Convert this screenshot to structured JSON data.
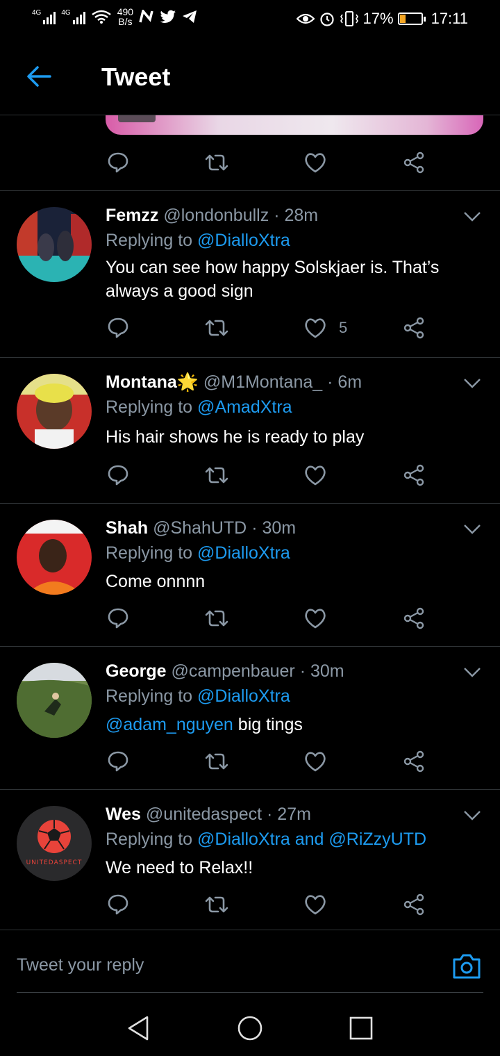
{
  "status_bar": {
    "net1": "4G",
    "net2": "4G",
    "speed_value": "490",
    "speed_unit": "B/s",
    "notif_icons": [
      "n-icon",
      "twitter-icon",
      "telegram-icon"
    ],
    "battery_percent": "17%",
    "time": "17:11"
  },
  "header": {
    "title": "Tweet"
  },
  "tweets": [
    {
      "name": "Femzz",
      "handle": "@londonbullz",
      "time": "· 28m",
      "replying_prefix": "Replying to",
      "replying_to": "@DialloXtra",
      "text": "You can see how happy Solskjaer is. That’s always a good sign",
      "likes": "5"
    },
    {
      "name": "Montana🌟",
      "handle": "@M1Montana_",
      "time": "· 6m",
      "replying_prefix": "Replying to",
      "replying_to": "@AmadXtra",
      "text": "His hair shows he is ready to play",
      "likes": ""
    },
    {
      "name": "Shah",
      "handle": "@ShahUTD",
      "time": "· 30m",
      "replying_prefix": "Replying to",
      "replying_to": "@DialloXtra",
      "text": "Come onnnn",
      "likes": ""
    },
    {
      "name": "George",
      "handle": "@campenbauer",
      "time": "· 30m",
      "replying_prefix": "Replying to",
      "replying_to": "@DialloXtra",
      "text_mention": "@adam_nguyen",
      "text": " big tings",
      "likes": ""
    },
    {
      "name": "Wes",
      "handle": "@unitedaspect",
      "time": "· 27m",
      "replying_prefix": "Replying to",
      "replying_to": "@DialloXtra and @RiZzyUTD",
      "text": "We need to Relax!!",
      "likes": "",
      "avatar_text": "UNITEDASPECT"
    }
  ],
  "reply_bar": {
    "placeholder": "Tweet your reply"
  },
  "colors": {
    "background": "#000000",
    "accent": "#1d9bf0",
    "secondary_text": "#8b98a5",
    "divider": "#2f3336"
  }
}
